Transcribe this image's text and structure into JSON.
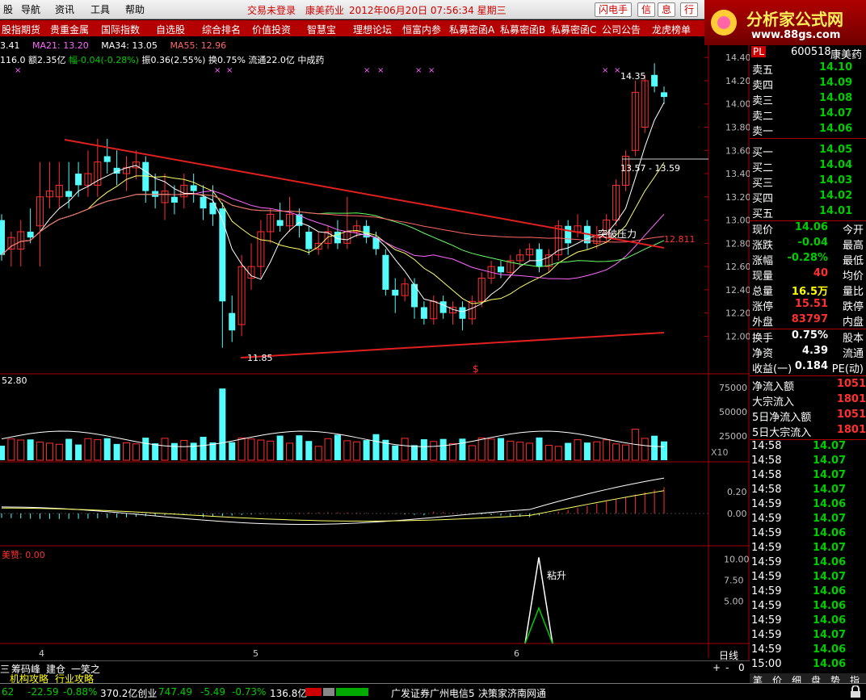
{
  "menu": {
    "items": [
      "股",
      "导航",
      "资讯",
      "工具",
      "帮助"
    ],
    "status": "交易未登录",
    "stock": "康美药业",
    "datetime": "2012年06月20日  07:56:34  星期三",
    "buttons": [
      "闪电手",
      "信",
      "息",
      "行"
    ]
  },
  "logo": {
    "title": "分析家公式网",
    "url": "www.88gs.com"
  },
  "nav": [
    "股指期货",
    "贵重金属",
    "国际指数",
    "自选股",
    "综合排名",
    "价值投资",
    "智慧宝",
    "理想论坛",
    "恒富内参",
    "私募密函A",
    "私募密函B",
    "私募密函C",
    "公司公告",
    "龙虎榜单"
  ],
  "ma_line": {
    "ma_a": "3.41",
    "ma21": "MA21: 13.20",
    "ma34": "MA34: 13.05",
    "ma55": "MA55: 12.96"
  },
  "info_line": {
    "prefix": "116.0 额2.35亿",
    "change": "幅-0.04(-0.28%)",
    "rest": "振0.36(2.55%) 换0.75% 流通22.0亿 中成药"
  },
  "annotations": {
    "high": "14.35",
    "range": "13.57 - 13.59",
    "break": "突破压力",
    "level": "12.811",
    "low": "11.85",
    "dollar": "$",
    "vol_label": "52.80",
    "x10": "X10",
    "indicator_label": "美赞: 0.00",
    "rise": "粘升",
    "months": [
      "4",
      "5",
      "6"
    ],
    "period": "日线"
  },
  "price_axis": [
    "14.40",
    "14.20",
    "14.00",
    "13.80",
    "13.60",
    "13.40",
    "13.20",
    "13.00",
    "12.80",
    "12.60",
    "12.40",
    "12.20",
    "12.00"
  ],
  "vol_axis": [
    "75000",
    "50000",
    "25000"
  ],
  "macd_axis": [
    "0.20",
    "0.00"
  ],
  "ind_axis": [
    "10.00",
    "7.50",
    "5.00"
  ],
  "quote": {
    "code_badge": "PL",
    "code": "600518",
    "name": "康美药",
    "asks": [
      {
        "label": "卖五",
        "price": "14.10"
      },
      {
        "label": "卖四",
        "price": "14.09"
      },
      {
        "label": "卖三",
        "price": "14.08"
      },
      {
        "label": "卖二",
        "price": "14.07"
      },
      {
        "label": "卖一",
        "price": "14.06"
      }
    ],
    "bids": [
      {
        "label": "买一",
        "price": "14.05"
      },
      {
        "label": "买二",
        "price": "14.04"
      },
      {
        "label": "买三",
        "price": "14.03"
      },
      {
        "label": "买四",
        "price": "14.02"
      },
      {
        "label": "买五",
        "price": "14.01"
      }
    ],
    "stats": [
      {
        "label": "现价",
        "value": "14.06",
        "label2": "今开",
        "color": "#00cc00"
      },
      {
        "label": "涨跌",
        "value": "-0.04",
        "label2": "最高",
        "color": "#00cc00"
      },
      {
        "label": "涨幅",
        "value": "-0.28%",
        "label2": "最低",
        "color": "#00cc00"
      },
      {
        "label": "现量",
        "value": "40",
        "label2": "均价",
        "color": "#ff3030"
      },
      {
        "label": "总量",
        "value": "16.5万",
        "label2": "量比",
        "color": "#ffff00"
      },
      {
        "label": "涨停",
        "value": "15.51",
        "label2": "跌停",
        "color": "#ff3030"
      },
      {
        "label": "外盘",
        "value": "83797",
        "label2": "内盘",
        "color": "#ff3030"
      }
    ],
    "stats2": [
      {
        "label": "换手",
        "value": "0.75%",
        "label2": "股本"
      },
      {
        "label": "净资",
        "value": "4.39",
        "label2": "流通"
      },
      {
        "label": "收益(一)",
        "value": "0.184",
        "label2": "PE(动)"
      }
    ],
    "flows": [
      {
        "label": "净流入额",
        "value": "1051"
      },
      {
        "label": "大宗流入",
        "value": "1801"
      },
      {
        "label": "5日净流入额",
        "value": "1051"
      },
      {
        "label": "5日大宗流入",
        "value": "1801"
      }
    ]
  },
  "ticks": [
    {
      "time": "14:58",
      "price": "14.07"
    },
    {
      "time": "14:58",
      "price": "14.07"
    },
    {
      "time": "14:58",
      "price": "14.07"
    },
    {
      "time": "14:58",
      "price": "14.07"
    },
    {
      "time": "14:59",
      "price": "14.06"
    },
    {
      "time": "14:59",
      "price": "14.07"
    },
    {
      "time": "14:59",
      "price": "14.06"
    },
    {
      "time": "14:59",
      "price": "14.07"
    },
    {
      "time": "14:59",
      "price": "14.06"
    },
    {
      "time": "14:59",
      "price": "14.07"
    },
    {
      "time": "14:59",
      "price": "14.06"
    },
    {
      "time": "14:59",
      "price": "14.06"
    },
    {
      "time": "14:59",
      "price": "14.06"
    },
    {
      "time": "14:59",
      "price": "14.07"
    },
    {
      "time": "14:59",
      "price": "14.06"
    },
    {
      "time": "15:00",
      "price": "14.06"
    }
  ],
  "bottom_tabs": [
    "三",
    "筹码峰",
    "建仓",
    "一笑之"
  ],
  "bottom_tabs2": [
    "机构攻略",
    "行业攻略"
  ],
  "bottom_controls": [
    "+",
    "-",
    "0"
  ],
  "right_tabs": [
    "笔",
    "价",
    "细",
    "盘",
    "势",
    "指"
  ],
  "status": {
    "a": "62",
    "b": "-22.59",
    "c": "-0.88%",
    "d": "370.2亿创业",
    "e": "747.49",
    "f": "-5.49",
    "g": "-0.73%",
    "h": "136.8亿",
    "i": "广发证券广州电信5",
    "j": "决策家济南网通"
  },
  "colors": {
    "up": "#ff3030",
    "down": "#54fcfc",
    "ma5": "#ffffff",
    "ma10": "#ffff66",
    "ma21": "#ff66ff",
    "ma34": "#66ff66",
    "ma55": "#ff6666",
    "trend": "#e02020"
  },
  "chart_data": {
    "type": "candlestick",
    "x": [
      "4",
      "5",
      "6"
    ],
    "ylim": [
      11.85,
      14.45
    ],
    "candles": [
      [
        13.0,
        12.7,
        13.05,
        12.65
      ],
      [
        12.75,
        12.85,
        12.9,
        12.6
      ],
      [
        12.75,
        12.9,
        13.0,
        12.6
      ],
      [
        12.9,
        12.85,
        13.1,
        12.8
      ],
      [
        12.95,
        13.2,
        13.5,
        12.6
      ],
      [
        13.2,
        13.25,
        13.5,
        13.1
      ],
      [
        13.2,
        13.3,
        13.5,
        13.1
      ],
      [
        13.25,
        13.2,
        13.5,
        13.1
      ],
      [
        13.4,
        13.3,
        13.5,
        13.2
      ],
      [
        13.3,
        13.4,
        13.6,
        13.2
      ],
      [
        13.3,
        13.5,
        13.7,
        13.2
      ],
      [
        13.55,
        13.5,
        13.7,
        13.4
      ],
      [
        13.45,
        13.4,
        13.6,
        13.3
      ],
      [
        13.4,
        13.45,
        13.55,
        13.25
      ],
      [
        13.45,
        13.5,
        13.6,
        13.35
      ],
      [
        13.5,
        13.25,
        13.55,
        13.15
      ],
      [
        13.25,
        13.2,
        13.4,
        13.1
      ],
      [
        13.15,
        13.25,
        13.4,
        13.0
      ],
      [
        13.2,
        13.15,
        13.3,
        13.05
      ],
      [
        13.2,
        13.3,
        13.4,
        13.1
      ],
      [
        13.3,
        13.25,
        13.4,
        13.15
      ],
      [
        13.2,
        13.1,
        13.3,
        13.0
      ],
      [
        13.15,
        13.05,
        13.3,
        12.95
      ],
      [
        13.1,
        12.3,
        13.15,
        11.9
      ],
      [
        12.2,
        12.05,
        12.35,
        11.95
      ],
      [
        12.1,
        12.6,
        12.7,
        12.0
      ],
      [
        12.5,
        12.6,
        12.8,
        12.4
      ],
      [
        12.6,
        12.9,
        13.0,
        12.5
      ],
      [
        12.9,
        13.05,
        13.1,
        12.8
      ],
      [
        13.0,
        12.95,
        13.15,
        12.9
      ],
      [
        12.95,
        13.05,
        13.2,
        12.9
      ],
      [
        13.05,
        12.95,
        13.1,
        12.85
      ],
      [
        12.9,
        12.75,
        12.95,
        12.7
      ],
      [
        12.75,
        12.8,
        12.9,
        12.7
      ],
      [
        12.8,
        12.9,
        12.95,
        12.75
      ],
      [
        12.9,
        12.8,
        13.0,
        12.75
      ],
      [
        12.8,
        12.9,
        13.2,
        12.75
      ],
      [
        12.9,
        12.95,
        13.0,
        12.85
      ],
      [
        12.95,
        12.85,
        13.0,
        12.8
      ],
      [
        12.85,
        12.75,
        12.9,
        12.7
      ],
      [
        12.7,
        12.4,
        12.75,
        12.35
      ],
      [
        12.4,
        12.35,
        12.5,
        12.2
      ],
      [
        12.35,
        12.45,
        12.5,
        12.3
      ],
      [
        12.45,
        12.25,
        12.5,
        12.15
      ],
      [
        12.25,
        12.15,
        12.3,
        12.1
      ],
      [
        12.15,
        12.3,
        12.35,
        12.1
      ],
      [
        12.3,
        12.2,
        12.35,
        12.15
      ],
      [
        12.2,
        12.25,
        12.3,
        12.1
      ],
      [
        12.25,
        12.15,
        12.3,
        12.05
      ],
      [
        12.15,
        12.3,
        12.35,
        12.1
      ],
      [
        12.3,
        12.5,
        12.55,
        12.25
      ],
      [
        12.5,
        12.6,
        12.65,
        12.45
      ],
      [
        12.6,
        12.55,
        12.65,
        12.5
      ],
      [
        12.55,
        12.65,
        12.7,
        12.5
      ],
      [
        12.65,
        12.7,
        12.75,
        12.6
      ],
      [
        12.7,
        12.75,
        12.8,
        12.65
      ],
      [
        12.75,
        12.6,
        12.8,
        12.55
      ],
      [
        12.6,
        12.7,
        12.75,
        12.55
      ],
      [
        12.7,
        12.95,
        13.0,
        12.65
      ],
      [
        12.95,
        12.8,
        13.0,
        12.7
      ],
      [
        12.9,
        12.95,
        13.05,
        12.85
      ],
      [
        12.95,
        12.8,
        13.0,
        12.75
      ],
      [
        12.8,
        12.85,
        12.95,
        12.75
      ],
      [
        12.85,
        13.0,
        13.05,
        12.8
      ],
      [
        13.0,
        13.3,
        13.35,
        12.95
      ],
      [
        13.3,
        13.55,
        13.6,
        13.25
      ],
      [
        13.6,
        14.1,
        14.2,
        13.55
      ],
      [
        13.8,
        14.2,
        14.25,
        13.75
      ],
      [
        14.25,
        14.15,
        14.35,
        14.1
      ],
      [
        14.1,
        14.06,
        14.15,
        14.0
      ]
    ]
  }
}
